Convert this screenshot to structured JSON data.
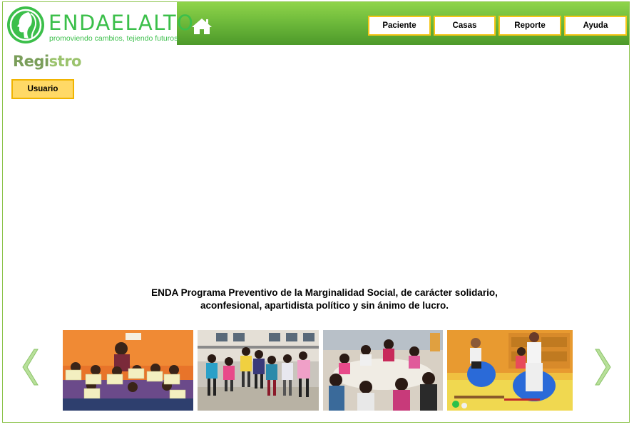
{
  "brand": {
    "name": "ENDAELALTO",
    "tagline": "promoviendo cambios, tejiendo futuros"
  },
  "nav": {
    "items": [
      {
        "label": "Paciente"
      },
      {
        "label": "Casas"
      },
      {
        "label": "Reporte"
      },
      {
        "label": "Ayuda"
      }
    ]
  },
  "page": {
    "title_part1": "Regi",
    "title_part2": "stro",
    "usuario_label": "Usuario"
  },
  "mission": {
    "line1": "ENDA Programa Preventivo de la Marginalidad Social, de carácter solidario,",
    "line2": "aconfesional, apartidista político y sin ánimo de lucro."
  },
  "colors": {
    "header_green": "#6cb83a",
    "brand_green": "#3bbf4a",
    "button_border": "#f5c518",
    "usuario_bg": "#ffd966"
  },
  "icons": {
    "home": "home-icon",
    "prev": "chevron-left-icon",
    "next": "chevron-right-icon"
  }
}
